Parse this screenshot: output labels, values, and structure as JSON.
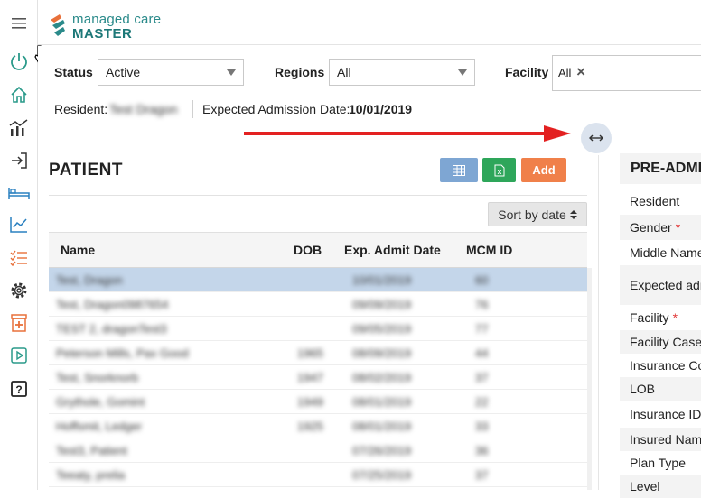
{
  "app": {
    "logo_line1": "managed care",
    "logo_line2": "MASTER"
  },
  "sidebar": {
    "items": [
      {
        "name": "menu-icon"
      },
      {
        "name": "power-icon"
      },
      {
        "name": "home-icon"
      },
      {
        "name": "analytics-icon"
      },
      {
        "name": "sign-in-icon"
      },
      {
        "name": "bed-icon"
      },
      {
        "name": "trend-chart-icon"
      },
      {
        "name": "checklist-icon"
      },
      {
        "name": "gear-icon"
      },
      {
        "name": "medical-kit-icon"
      },
      {
        "name": "play-box-icon"
      },
      {
        "name": "help-icon"
      }
    ]
  },
  "filters": {
    "status_label": "Status",
    "status_value": "Active",
    "regions_label": "Regions",
    "regions_value": "All",
    "facility_label": "Facility",
    "facility_chip": "All",
    "facility_chip_remove": "×"
  },
  "resident_info": {
    "resident_label": "Resident:",
    "resident_value": "Test Dragon",
    "admission_label": "Expected Admission Date:",
    "admission_value": "10/01/2019"
  },
  "patient": {
    "title": "PATIENT",
    "add_label": "Add",
    "sort_label": "Sort by date",
    "columns": [
      "Name",
      "DOB",
      "Exp. Admit Date",
      "MCM ID"
    ],
    "rows": [
      {
        "name": "Test, Dragon",
        "dob": "",
        "admit": "10/01/2019",
        "id": "60"
      },
      {
        "name": "Test, Dragon0987654",
        "dob": "",
        "admit": "09/09/2019",
        "id": "76"
      },
      {
        "name": "TEST 2, dragonTest3",
        "dob": "",
        "admit": "09/05/2019",
        "id": "77"
      },
      {
        "name": "Peterson Mills, Pax Good",
        "dob": "1965",
        "admit": "08/09/2019",
        "id": "44"
      },
      {
        "name": "Test, Snorknorb",
        "dob": "1947",
        "admit": "08/02/2019",
        "id": "37"
      },
      {
        "name": "Grythole, Gomint",
        "dob": "1949",
        "admit": "08/01/2019",
        "id": "22"
      },
      {
        "name": "Hoffsmit, Ledger",
        "dob": "1925",
        "admit": "08/01/2019",
        "id": "33"
      },
      {
        "name": "Test3, Patient",
        "dob": "",
        "admit": "07/26/2019",
        "id": "36"
      },
      {
        "name": "Teeaty, prelia",
        "dob": "",
        "admit": "07/25/2019",
        "id": "37"
      }
    ]
  },
  "pre_admission": {
    "title": "PRE-ADMISSION",
    "fields": [
      {
        "label": "Resident",
        "required": false
      },
      {
        "label": "Gender",
        "required": true
      },
      {
        "label": "Middle Name",
        "required": false
      },
      {
        "label": "Expected admission date",
        "required": false
      },
      {
        "label": "Facility",
        "required": true
      },
      {
        "label": "Facility Case",
        "required": false
      },
      {
        "label": "Insurance Co",
        "required": false
      },
      {
        "label": "LOB",
        "required": false
      },
      {
        "label": "Insurance ID",
        "required": false
      },
      {
        "label": "Insured Name",
        "required": false
      },
      {
        "label": "Plan Type",
        "required": false
      },
      {
        "label": "Level",
        "required": false
      }
    ]
  },
  "colors": {
    "grid_button": "#7ea6d3",
    "excel_button": "#2ea65a",
    "add_button": "#f0804a",
    "selected_row": "#c4d6ea",
    "brand_teal": "#2a8a8a",
    "annotation_arrow": "#e32121"
  }
}
